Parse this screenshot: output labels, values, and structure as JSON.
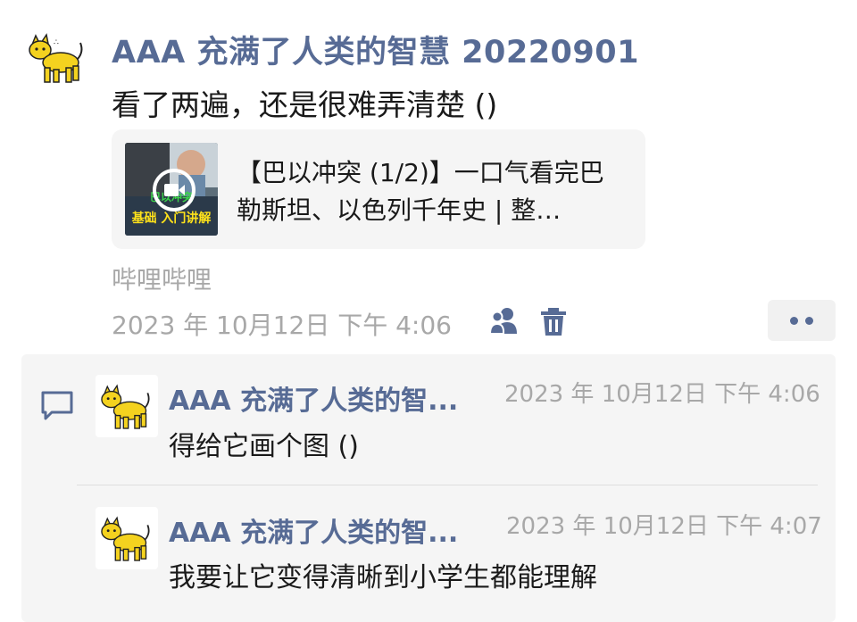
{
  "post": {
    "author": "AAA 充满了人类的智慧 20220901",
    "text": "看了两遍，还是很难弄清楚 ()",
    "link_card": {
      "title_line1": "【巴以冲突 (1/2)】一口气看完巴",
      "title_line2": "勒斯坦、以色列千年史 | 整…",
      "thumb_caption_top": "巴以冲突",
      "thumb_caption_bottom": "基础  入门讲解"
    },
    "source": "哔哩哔哩",
    "timestamp": "2023 年 10月12日 下午 4:06"
  },
  "comments": [
    {
      "author": "AAA 充满了人类的智...",
      "time": "2023 年 10月12日 下午 4:06",
      "text": "得给它画个图 ()"
    },
    {
      "author": "AAA 充满了人类的智...",
      "time": "2023 年 10月12日 下午 4:07",
      "text": "我要让它变得清晰到小学生都能理解"
    }
  ],
  "icons": [
    "cat-avatar-icon",
    "visibility-friends-icon",
    "trash-icon",
    "more-dots-icon",
    "comment-bubble-icon",
    "video-play-icon"
  ],
  "colors": {
    "link_blue": "#576b95",
    "secondary_gray": "#a8a8a8",
    "panel_bg": "#f5f5f5",
    "avatar_yellow": "#f4d21f"
  }
}
